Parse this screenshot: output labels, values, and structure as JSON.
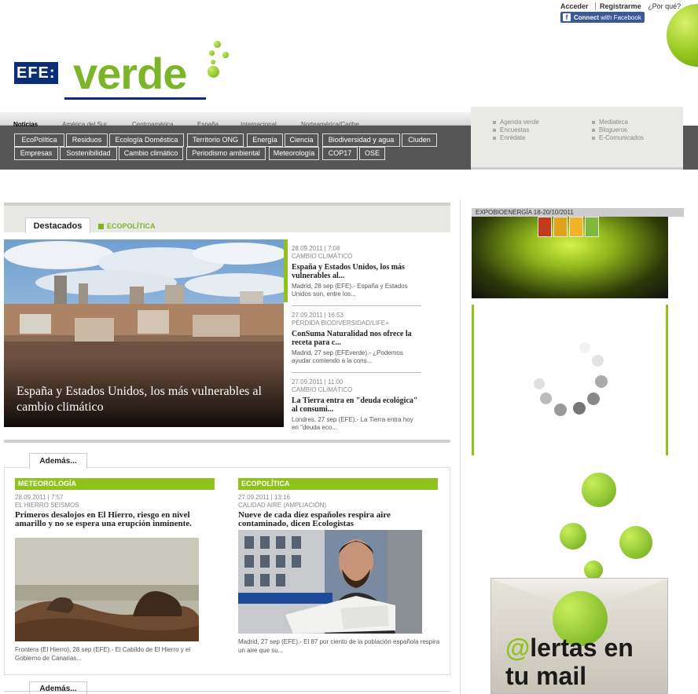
{
  "header": {
    "login": "Acceder",
    "register": "Registrarme",
    "why": "¿Por qué?",
    "facebook_label": "Connect",
    "facebook_with": "with Facebook",
    "logo_efe": "EFE:",
    "logo_verde": "verde"
  },
  "nav": {
    "tabs": [
      "Noticias",
      "América del Sur",
      "Centroamérica",
      "España",
      "Internacional",
      "Norteamérica/Caribe"
    ],
    "row1": [
      "EcoPolítica",
      "Residuos",
      "Ecología Doméstica",
      "Territorio ONG",
      "Energía",
      "Ciencia",
      "Biodiversidad y agua",
      "Ciuden"
    ],
    "row2": [
      "Empresas",
      "Sostenibilidad",
      "Cambio climático",
      "Periodismo ambiental",
      "Meteorología",
      "COP17",
      "OSE"
    ],
    "right_col1": [
      "Agenda verde",
      "Encuestas",
      "Enrédate"
    ],
    "right_col2": [
      "Mediateca",
      "Blogueros",
      "E-Comunicados"
    ]
  },
  "destacados": {
    "tab_active": "Destacados",
    "tab_other": "ECOPOLÍTICA",
    "main_caption": "España y Estados Unidos, los más vulnerables al cambio climático",
    "stories": [
      {
        "meta1": "28.09.2011 | 7:08",
        "meta2": "CAMBIO CLIMÁTICO",
        "title": "España y Estados Unidos, los más vulnerables al...",
        "snippet": "Madrid, 28 sep (EFE).- España y Estados Unidos son, entre los..."
      },
      {
        "meta1": "27.09.2011 | 16:53",
        "meta2": "PÉRDIDA BIODIVERSIDAD/LIFE+",
        "title": "ConSuma Naturalidad nos ofrece la receta para c...",
        "snippet": "Madrid, 27 sep (EFEverde).- ¿Podemos ayudar comiendo a la cons..."
      },
      {
        "meta1": "27.09.2011 | 11:00",
        "meta2": "CAMBIO CLIMÁTICO",
        "title": "La Tierra entra en \"deuda ecológica\" al consumi...",
        "snippet": "Londres, 27 sep (EFE).- La Tierra entra hoy en \"deuda eco..."
      }
    ]
  },
  "ademas": {
    "tab": "Además...",
    "tab2": "Además...",
    "left": {
      "section": "METEOROLOGÍA",
      "meta1": "28.09.2011 | 7:57",
      "meta2": "EL HIERRO SEISMOS",
      "title": "Primeros desalojos en El Hierro, riesgo en nivel amarillo y no se espera una erupción inminente.",
      "snippet": "Frontera (El Hierro), 28 sep (EFE).- El Cabildo de El Hierro y el Gobierno de Canarias..."
    },
    "right": {
      "section": "ECOPOLÍTICA",
      "meta1": "27.09.2011 | 13:16",
      "meta2": "CALIDAD AIRE (AMPLIACIÓN)",
      "title": "Nueve de cada diez españoles respira aire contaminado, dicen Ecologistas",
      "snippet": "Madrid, 27 sep (EFE).- El 87 por ciento de la población española respira un aire que su..."
    }
  },
  "sidebar": {
    "expo_label": "EXPOBIOENERGÍA 18-20/10/2011",
    "alertas_line1": "@lertas en",
    "alertas_line2": "tu mail"
  },
  "colors": {
    "accent_green": "#8fc21a",
    "logo_blue": "#0a2d78",
    "nav_gray": "#565656"
  }
}
